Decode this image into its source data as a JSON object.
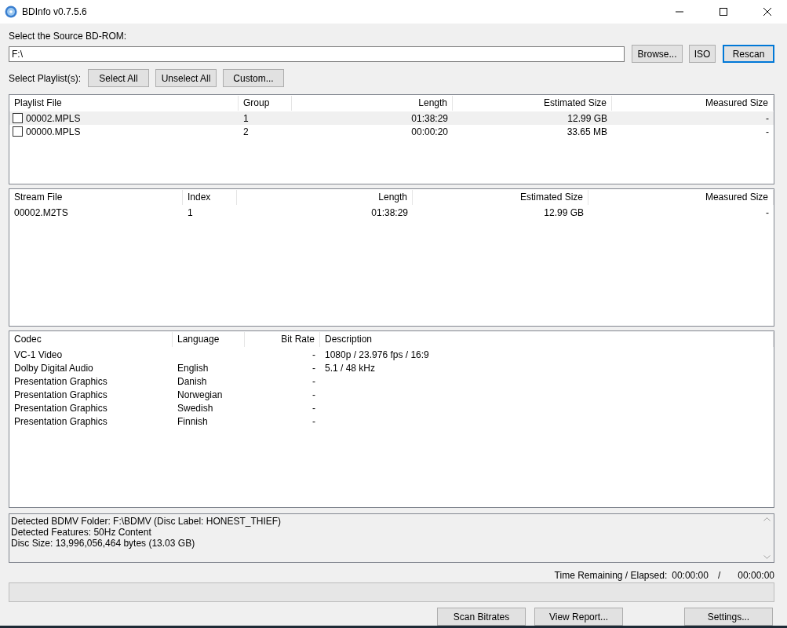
{
  "window": {
    "title": "BDInfo v0.7.5.6"
  },
  "source": {
    "label": "Select the Source BD-ROM:",
    "value": "F:\\",
    "buttons": [
      {
        "label": "Browse...",
        "focused": false
      },
      {
        "label": "ISO",
        "focused": false
      },
      {
        "label": "Rescan",
        "focused": true
      }
    ]
  },
  "playlist_select": {
    "label": "Select Playlist(s):",
    "buttons": [
      "Select All",
      "Unselect All",
      "Custom..."
    ]
  },
  "playlist_table": {
    "columns": [
      "Playlist File",
      "Group",
      "Length",
      "Estimated Size",
      "Measured Size"
    ],
    "rows": [
      {
        "checked": false,
        "selected": true,
        "cells": [
          "00002.MPLS",
          "1",
          "01:38:29",
          "12.99 GB",
          "-"
        ]
      },
      {
        "checked": false,
        "selected": false,
        "cells": [
          "00000.MPLS",
          "2",
          "00:00:20",
          "33.65 MB",
          "-"
        ]
      }
    ]
  },
  "stream_table": {
    "columns": [
      "Stream File",
      "Index",
      "Length",
      "Estimated Size",
      "Measured Size"
    ],
    "rows": [
      {
        "cells": [
          "00002.M2TS",
          "1",
          "01:38:29",
          "12.99 GB",
          "-"
        ]
      }
    ]
  },
  "codec_table": {
    "columns": [
      "Codec",
      "Language",
      "Bit Rate",
      "Description"
    ],
    "rows": [
      {
        "cells": [
          "VC-1 Video",
          "",
          "-",
          "1080p / 23.976 fps / 16:9"
        ]
      },
      {
        "cells": [
          "Dolby Digital Audio",
          "English",
          "-",
          "5.1 / 48 kHz"
        ]
      },
      {
        "cells": [
          "Presentation Graphics",
          "Danish",
          "-",
          ""
        ]
      },
      {
        "cells": [
          "Presentation Graphics",
          "Norwegian",
          "-",
          ""
        ]
      },
      {
        "cells": [
          "Presentation Graphics",
          "Swedish",
          "-",
          ""
        ]
      },
      {
        "cells": [
          "Presentation Graphics",
          "Finnish",
          "-",
          ""
        ]
      }
    ]
  },
  "log": [
    "Detected BDMV Folder: F:\\BDMV (Disc Label: HONEST_THIEF)",
    "Detected Features: 50Hz Content",
    "Disc Size: 13,996,056,464 bytes (13.03 GB)"
  ],
  "time": {
    "label": "Time Remaining / Elapsed:",
    "remaining": "00:00:00",
    "separator": "/",
    "elapsed": "00:00:00"
  },
  "progress": {
    "level": 0
  },
  "bottom_buttons": [
    "Scan Bitrates",
    "View Report...",
    "Settings..."
  ]
}
